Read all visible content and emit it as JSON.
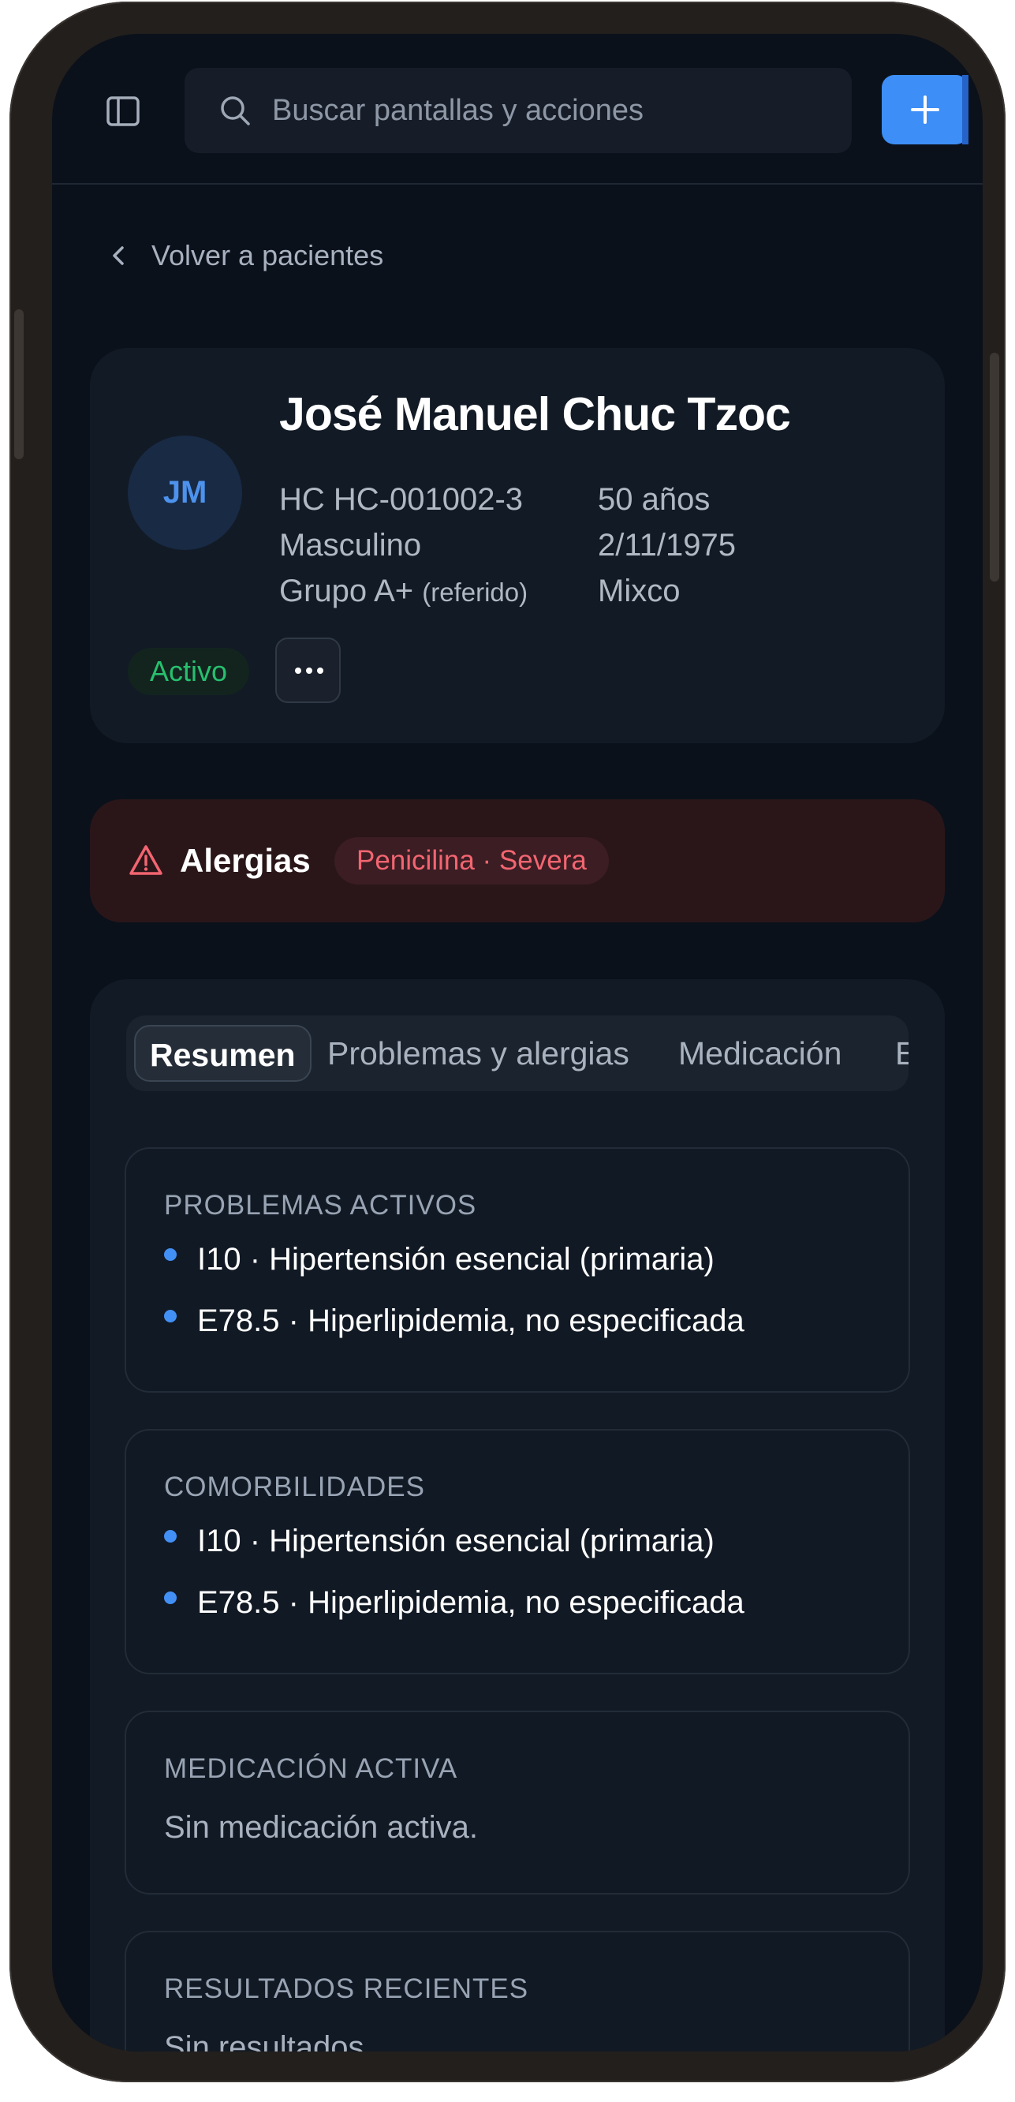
{
  "header": {
    "search_placeholder": "Buscar pantallas y acciones",
    "add_icon": "plus-icon",
    "sidebar_icon": "sidebar-toggle-icon"
  },
  "nav": {
    "back_label": "Volver a pacientes"
  },
  "patient": {
    "initials": "JM",
    "name": "José Manuel Chuc Tzoc",
    "record": "HC HC-001002-3",
    "age": "50 años",
    "sex": "Masculino",
    "birthdate": "2/11/1975",
    "blood_group": "Grupo A+",
    "blood_note": "(referido)",
    "location": "Mixco",
    "status": "Activo"
  },
  "allergies": {
    "label": "Alergias",
    "items": [
      "Penicilina · Severa"
    ]
  },
  "tabs": [
    "Resumen",
    "Problemas y alergias",
    "Medicación",
    "E"
  ],
  "sections": {
    "active_problems": {
      "title": "PROBLEMAS ACTIVOS",
      "items": [
        "I10 · Hipertensión esencial (primaria)",
        "E78.5 · Hiperlipidemia, no especificada"
      ]
    },
    "comorbidities": {
      "title": "COMORBILIDADES",
      "items": [
        "I10 · Hipertensión esencial (primaria)",
        "E78.5 · Hiperlipidemia, no especificada"
      ]
    },
    "active_medication": {
      "title": "MEDICACIÓN ACTIVA",
      "empty": "Sin medicación activa."
    },
    "recent_results": {
      "title": "RESULTADOS RECIENTES",
      "empty": "Sin resultados"
    }
  },
  "colors": {
    "accent": "#3d8ef7",
    "status_active": "#27c06e",
    "allergy": "#f26571",
    "background": "#0b111b"
  }
}
